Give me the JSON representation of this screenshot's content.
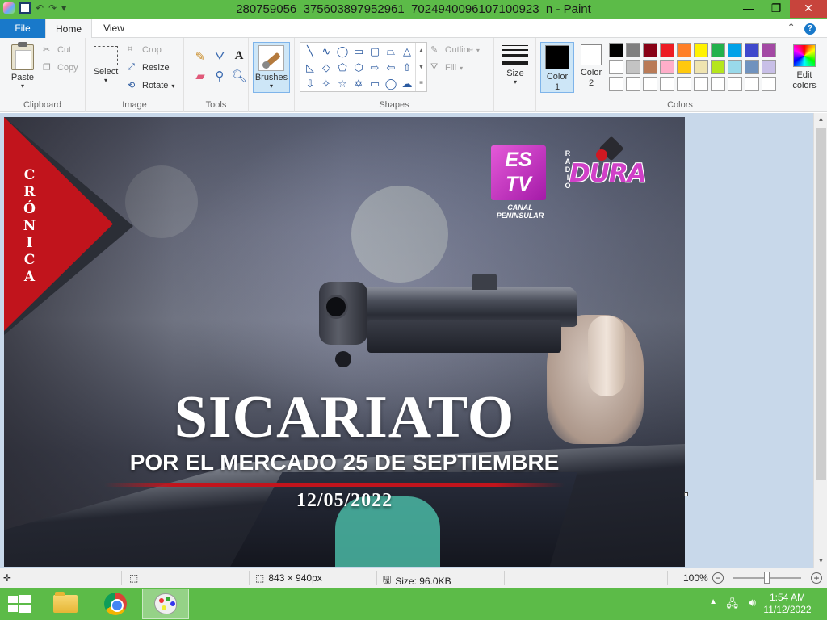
{
  "window": {
    "title": "280759056_375603897952961_7024940096107100923_n - Paint",
    "controls": {
      "minimize": "—",
      "maximize": "❐",
      "close": "✕"
    }
  },
  "tabs": {
    "file": "File",
    "home": "Home",
    "view": "View"
  },
  "ribbon": {
    "clipboard": {
      "paste": "Paste",
      "cut": "Cut",
      "copy": "Copy",
      "group": "Clipboard"
    },
    "image": {
      "select": "Select",
      "crop": "Crop",
      "resize": "Resize",
      "rotate": "Rotate",
      "group": "Image"
    },
    "tools": {
      "group": "Tools"
    },
    "brushes": {
      "label": "Brushes"
    },
    "shapes": {
      "outline": "Outline",
      "fill": "Fill",
      "group": "Shapes"
    },
    "size": {
      "label": "Size"
    },
    "colors": {
      "color1": "Color\n1",
      "color1_label": "Color",
      "color1_num": "1",
      "color2_label": "Color",
      "color2_num": "2",
      "edit_label": "Edit",
      "edit_label2": "colors",
      "group": "Colors",
      "color1_value": "#000000",
      "color2_value": "#ffffff",
      "palette": [
        "#000000",
        "#7f7f7f",
        "#880015",
        "#ed1c24",
        "#ff7f27",
        "#fff200",
        "#22b14c",
        "#00a2e8",
        "#3f48cc",
        "#a349a4",
        "#ffffff",
        "#c3c3c3",
        "#b97a57",
        "#ffaec9",
        "#ffc90e",
        "#efe4b0",
        "#b5e61d",
        "#99d9ea",
        "#7092be",
        "#c8bfe7",
        "#ffffff",
        "#ffffff",
        "#ffffff",
        "#ffffff",
        "#ffffff",
        "#ffffff",
        "#ffffff",
        "#ffffff",
        "#ffffff",
        "#ffffff"
      ]
    }
  },
  "image_content": {
    "side_label": [
      "C",
      "R",
      "Ó",
      "N",
      "I",
      "C",
      "A"
    ],
    "logo_es": "ES",
    "logo_tv": "TV",
    "canal": "CANAL PENINSULAR",
    "radio": [
      "R",
      "A",
      "D",
      "I",
      "O"
    ],
    "dura": "DURA",
    "headline": "SICARIATO",
    "subheadline": "POR EL MERCADO 25 DE SEPTIEMBRE",
    "date": "12/05/2022"
  },
  "statusbar": {
    "dimensions": "843 × 940px",
    "size": "Size: 96.0KB",
    "zoom": "100%"
  },
  "taskbar": {
    "time": "1:54 AM",
    "date": "11/12/2022"
  }
}
